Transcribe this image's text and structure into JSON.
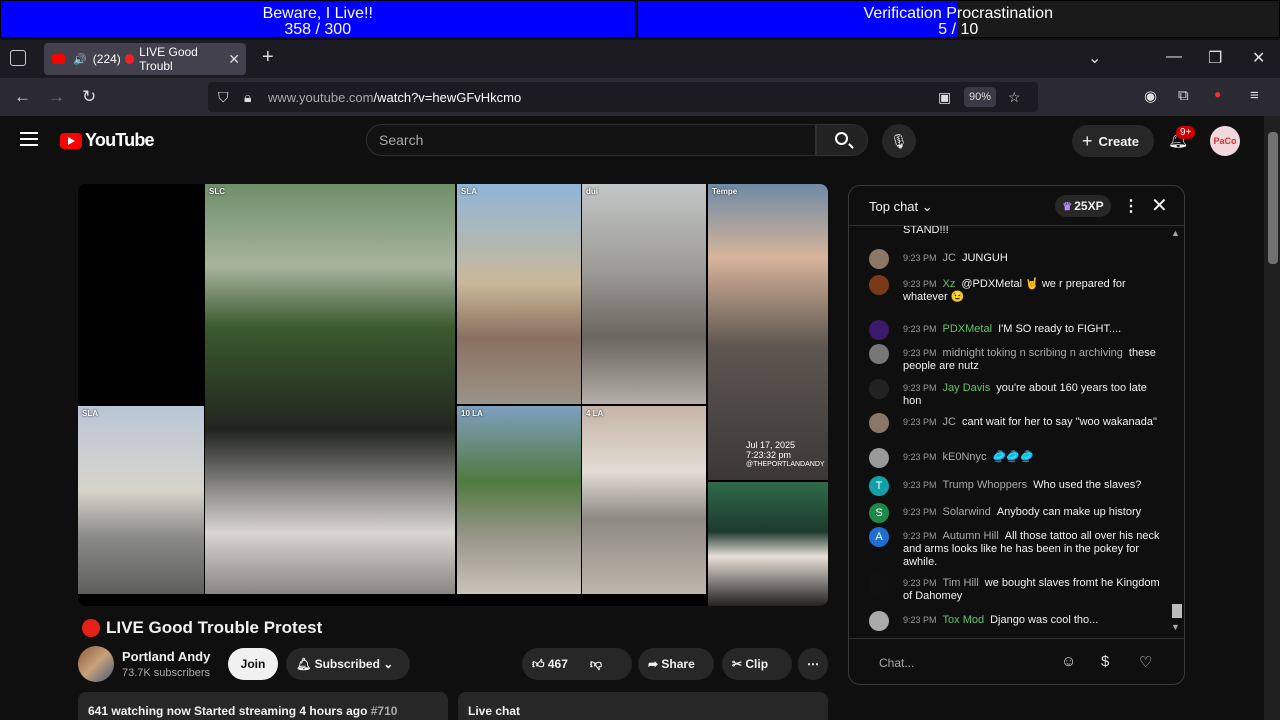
{
  "banners": [
    {
      "title": "Beware, I Live!!",
      "progress": "358 / 300",
      "fill_fraction": 1.0,
      "color": "#0000ff"
    },
    {
      "title": "Verification Procrastination",
      "progress": "5 / 10",
      "fill_fraction": 0.5,
      "color": "#0000ff"
    }
  ],
  "browser": {
    "tab_title": "(224) 🔴 LIVE Good Troubl",
    "tab_count": "(224)",
    "tab_label": "LIVE Good Troubl",
    "url_host": "www.youtube.com",
    "url_path": "/watch?v=hewGFvHkcmo",
    "zoom": "90%"
  },
  "youtube": {
    "logo": "YouTube",
    "search_placeholder": "Search",
    "create_label": "Create",
    "notifications_badge": "9+",
    "account_avatar_text": "PaCo"
  },
  "video": {
    "tags": [
      "SLC",
      "SLA",
      "dui",
      "Tempe",
      "SLA",
      "10 LA",
      "4 LA"
    ],
    "overlay_date": "Jul 17, 2025",
    "overlay_time": "7:23:32 pm",
    "overlay_handle": "@THEPORTLANDANDY",
    "title": "LIVE Good Trouble Protest"
  },
  "channel": {
    "name": "Portland Andy",
    "subscribers": "73.7K subscribers",
    "join_label": "Join",
    "subscribed_label": "Subscribed",
    "likes": "467",
    "share_label": "Share",
    "clip_label": "Clip"
  },
  "info": {
    "watching": "641 watching now",
    "started": "Started streaming 4 hours ago",
    "tag": "#710",
    "live_chat_label": "Live chat"
  },
  "chat": {
    "header": "Top chat",
    "xp": "25XP",
    "input_placeholder": "Chat...",
    "partial_top": "STAND!!!",
    "messages": [
      {
        "time": "9:23 PM",
        "name": "JC",
        "text": "JUNGUH",
        "name_color": "#aaaaaa",
        "avatar_color": "#8a7766",
        "avatar_text": ""
      },
      {
        "time": "9:23 PM",
        "name": "Xz",
        "text": "@PDXMetal 🤘 we r prepared for whatever 😉",
        "name_color": "#5ec466",
        "avatar_color": "#7a3a1a",
        "avatar_text": ""
      },
      {
        "time": "9:23 PM",
        "name": "PDXMetal",
        "text": "I'M SO ready to FIGHT....",
        "name_color": "#5ec466",
        "avatar_color": "#3a1a6a",
        "avatar_text": ""
      },
      {
        "time": "9:23 PM",
        "name": "midnight toking n scribing n archiving",
        "text": "these people are nutz",
        "name_color": "#aaaaaa",
        "avatar_color": "#777777",
        "avatar_text": ""
      },
      {
        "time": "9:23 PM",
        "name": "Jay Davis",
        "text": "you're about 160 years too late hon",
        "name_color": "#5ec466",
        "avatar_color": "#222222",
        "avatar_text": ""
      },
      {
        "time": "9:23 PM",
        "name": "JC",
        "text": "cant wait for her to say \"woo wakanada\"",
        "name_color": "#aaaaaa",
        "avatar_color": "#8a7766",
        "avatar_text": ""
      },
      {
        "time": "9:23 PM",
        "name": "kE0Nnyc",
        "text": "🥏🥏🥏",
        "name_color": "#aaaaaa",
        "avatar_color": "#999999",
        "avatar_text": ""
      },
      {
        "time": "9:23 PM",
        "name": "Trump Whoppers",
        "text": "Who used the slaves?",
        "name_color": "#aaaaaa",
        "avatar_color": "#12a0a8",
        "avatar_text": "T"
      },
      {
        "time": "9:23 PM",
        "name": "Solarwind",
        "text": "Anybody can make up history",
        "name_color": "#aaaaaa",
        "avatar_color": "#1e8a4a",
        "avatar_text": "S"
      },
      {
        "time": "9:23 PM",
        "name": "Autumn Hill",
        "text": "All those tattoo all over his neck and arms looks like he has been in the pokey for awhile.",
        "name_color": "#aaaaaa",
        "avatar_color": "#1e6fd0",
        "avatar_text": "A"
      },
      {
        "time": "9:23 PM",
        "name": "Tim Hill",
        "text": "we bought slaves fromt he Kingdom of Dahomey",
        "name_color": "#aaaaaa",
        "avatar_color": "#111111",
        "avatar_text": ""
      },
      {
        "time": "9:23 PM",
        "name": "Tox Mod",
        "text": "Django was cool tho...",
        "name_color": "#5ec466",
        "avatar_color": "#aaaaaa",
        "avatar_text": ""
      }
    ]
  }
}
